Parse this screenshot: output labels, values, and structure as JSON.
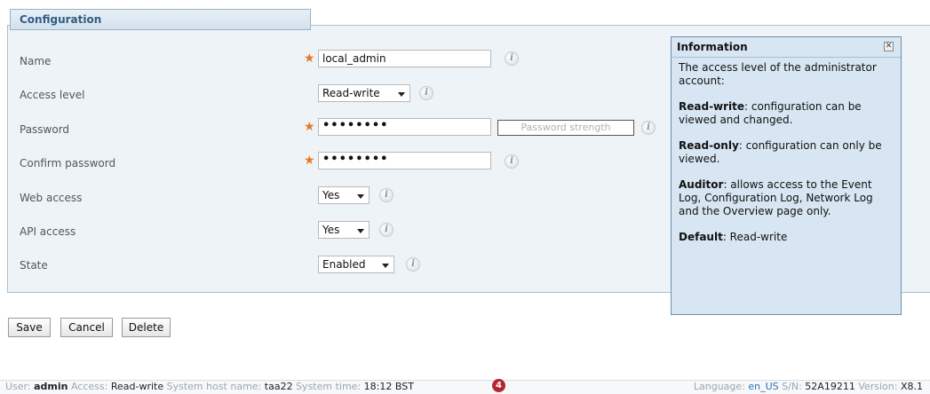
{
  "panel": {
    "title": "Configuration"
  },
  "form": {
    "name": {
      "label": "Name",
      "value": "local_admin",
      "required_mark": "★"
    },
    "access_level": {
      "label": "Access level",
      "value": "Read-write"
    },
    "password": {
      "label": "Password",
      "value": "••••••••",
      "required_mark": "★",
      "strength_label": "Password strength"
    },
    "confirm_password": {
      "label": "Confirm password",
      "value": "••••••••",
      "required_mark": "★"
    },
    "web_access": {
      "label": "Web access",
      "value": "Yes"
    },
    "api_access": {
      "label": "API access",
      "value": "Yes"
    },
    "state": {
      "label": "State",
      "value": "Enabled"
    }
  },
  "info_icon_glyph": "i",
  "infobox": {
    "title": "Information",
    "close_glyph": "✕",
    "intro": "The access level of the administrator account:",
    "items": [
      {
        "term": "Read-write",
        "text": ": configuration can be viewed and changed."
      },
      {
        "term": "Read-only",
        "text": ": configuration can only be viewed."
      },
      {
        "term": "Auditor",
        "text": ": allows access to the Event Log, Configuration Log, Network Log and the Overview page only."
      },
      {
        "term": "Default",
        "text": ": Read-write"
      }
    ]
  },
  "buttons": {
    "save": "Save",
    "cancel": "Cancel",
    "delete": "Delete"
  },
  "footer": {
    "user_label": "User:",
    "user": "admin",
    "access_label": "Access:",
    "access": "Read-write",
    "host_label": "System host name:",
    "host": "taa22",
    "time_label": "System time:",
    "time": "18:12 BST",
    "alert_count": "4",
    "language_label": "Language:",
    "language": "en_US",
    "sn_label": "S/N:",
    "sn": "52A19211",
    "version_label": "Version:",
    "version": "X8.1"
  },
  "colors": {
    "required": "#e87722",
    "panel_title": "#2f5d83",
    "alert": "#b3262e",
    "link": "#2f6fb0"
  }
}
